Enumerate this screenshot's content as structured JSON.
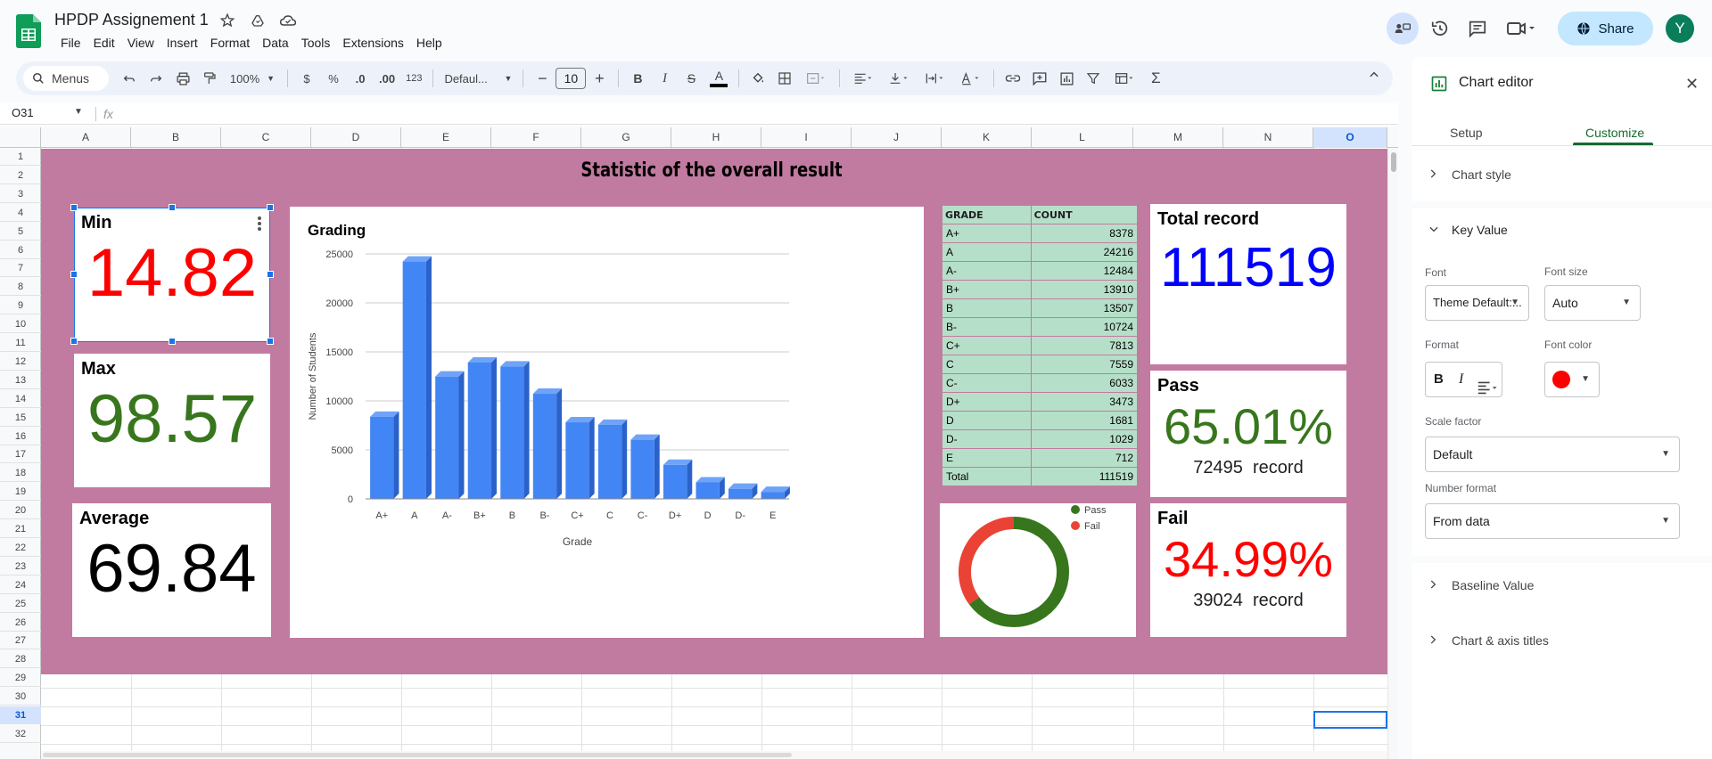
{
  "app": {
    "doc_title": "HPDP Assignement 1"
  },
  "menu": [
    "File",
    "Edit",
    "View",
    "Insert",
    "Format",
    "Data",
    "Tools",
    "Extensions",
    "Help"
  ],
  "header": {
    "share_label": "Share",
    "avatar_letter": "Y"
  },
  "toolbar": {
    "menus_label": "Menus",
    "zoom": "100%",
    "currency": "$",
    "percent": "%",
    "dec_decrease": ".0",
    "dec_increase": ".00",
    "number_format": "123",
    "font": "Defaul...",
    "font_size": "10"
  },
  "formula_bar": {
    "name_box": "O31",
    "fx": "fx"
  },
  "columns": [
    "A",
    "B",
    "C",
    "D",
    "E",
    "F",
    "G",
    "H",
    "I",
    "J",
    "K",
    "L",
    "M",
    "N",
    "O"
  ],
  "selected_column": "O",
  "rows": [
    "1",
    "2",
    "3",
    "4",
    "5",
    "6",
    "7",
    "8",
    "9",
    "10",
    "11",
    "12",
    "13",
    "14",
    "15",
    "16",
    "17",
    "18",
    "19",
    "20",
    "21",
    "22",
    "23",
    "24",
    "25",
    "26",
    "27",
    "28",
    "29",
    "30",
    "31",
    "32"
  ],
  "selected_row": "31",
  "dashboard": {
    "title": "Statistic of the overall result",
    "min": {
      "label": "Min",
      "value": "14.82",
      "color": "#ff0000"
    },
    "max": {
      "label": "Max",
      "value": "98.57",
      "color": "#38761d"
    },
    "average": {
      "label": "Average",
      "value": "69.84",
      "color": "#000000"
    },
    "total": {
      "label": "Total record",
      "value": "111519",
      "color": "#0000ff"
    },
    "pass": {
      "label": "Pass",
      "value": "65.01%",
      "count": "72495",
      "unit": "record",
      "color": "#38761d"
    },
    "fail": {
      "label": "Fail",
      "value": "34.99%",
      "count": "39024",
      "unit": "record",
      "color": "#ff0000"
    }
  },
  "grade_table": {
    "headers": [
      "GRADE",
      "COUNT"
    ],
    "rows": [
      [
        "A+",
        "8378"
      ],
      [
        "A",
        "24216"
      ],
      [
        "A-",
        "12484"
      ],
      [
        "B+",
        "13910"
      ],
      [
        "B",
        "13507"
      ],
      [
        "B-",
        "10724"
      ],
      [
        "C+",
        "7813"
      ],
      [
        "C",
        "7559"
      ],
      [
        "C-",
        "6033"
      ],
      [
        "D+",
        "3473"
      ],
      [
        "D",
        "1681"
      ],
      [
        "D-",
        "1029"
      ],
      [
        "E",
        "712"
      ],
      [
        "Total",
        "111519"
      ]
    ]
  },
  "chart_data": [
    {
      "type": "bar",
      "title": "Grading",
      "xlabel": "Grade",
      "ylabel": "Number of Students",
      "categories": [
        "A+",
        "A",
        "A-",
        "B+",
        "B",
        "B-",
        "C+",
        "C",
        "C-",
        "D+",
        "D",
        "D-",
        "E"
      ],
      "values": [
        8378,
        24216,
        12484,
        13910,
        13507,
        10724,
        7813,
        7559,
        6033,
        3473,
        1681,
        1029,
        712
      ],
      "ylim": [
        0,
        25000
      ],
      "yticks": [
        "0",
        "5000",
        "10000",
        "15000",
        "20000",
        "25000"
      ],
      "color": "#4285f4",
      "grid": true
    },
    {
      "type": "pie",
      "donut": true,
      "categories": [
        "Pass",
        "Fail"
      ],
      "values": [
        65.01,
        34.99
      ],
      "colors": [
        "#38761d",
        "#ea4335"
      ],
      "legend": "top-right"
    }
  ],
  "chart_editor": {
    "title": "Chart editor",
    "tabs": [
      "Setup",
      "Customize"
    ],
    "active_tab": "Customize",
    "sections": {
      "chart_style": "Chart style",
      "key_value": "Key Value",
      "baseline_value": "Baseline Value",
      "chart_axis_titles": "Chart & axis titles"
    },
    "fields": {
      "font_label": "Font",
      "font_value": "Theme Default:...",
      "font_size_label": "Font size",
      "font_size_value": "Auto",
      "format_label": "Format",
      "font_color_label": "Font color",
      "font_color_value": "#ff0000",
      "scale_factor_label": "Scale factor",
      "scale_factor_value": "Default",
      "number_format_label": "Number format",
      "number_format_value": "From data"
    }
  }
}
